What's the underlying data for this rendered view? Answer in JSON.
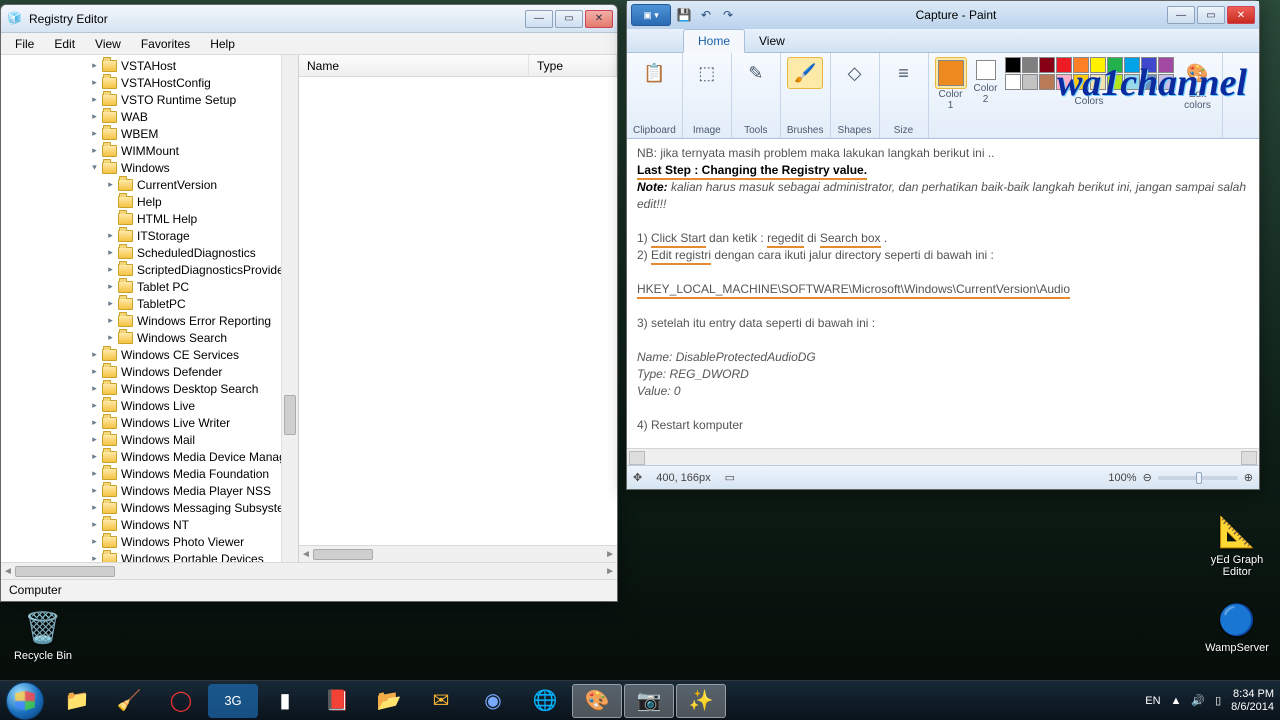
{
  "regedit": {
    "title": "Registry Editor",
    "menu": {
      "file": "File",
      "edit": "Edit",
      "view": "View",
      "favorites": "Favorites",
      "help": "Help"
    },
    "columns": {
      "name": "Name",
      "type": "Type"
    },
    "statusbar": "Computer",
    "tree_level1": [
      {
        "label": "VSTAHost"
      },
      {
        "label": "VSTAHostConfig"
      },
      {
        "label": "VSTO Runtime Setup"
      },
      {
        "label": "WAB"
      },
      {
        "label": "WBEM"
      },
      {
        "label": "WIMMount"
      }
    ],
    "windows_node": "Windows",
    "windows_children": [
      {
        "label": "CurrentVersion",
        "expandable": true
      },
      {
        "label": "Help",
        "expandable": false
      },
      {
        "label": "HTML Help",
        "expandable": false
      },
      {
        "label": "ITStorage",
        "expandable": true
      },
      {
        "label": "ScheduledDiagnostics",
        "expandable": true
      },
      {
        "label": "ScriptedDiagnosticsProvider",
        "expandable": true
      },
      {
        "label": "Tablet PC",
        "expandable": true
      },
      {
        "label": "TabletPC",
        "expandable": true
      },
      {
        "label": "Windows Error Reporting",
        "expandable": true
      },
      {
        "label": "Windows Search",
        "expandable": true
      }
    ],
    "tree_level1b": [
      {
        "label": "Windows CE Services"
      },
      {
        "label": "Windows Defender"
      },
      {
        "label": "Windows Desktop Search"
      },
      {
        "label": "Windows Live"
      },
      {
        "label": "Windows Live Writer"
      },
      {
        "label": "Windows Mail"
      },
      {
        "label": "Windows Media Device Manager"
      },
      {
        "label": "Windows Media Foundation"
      },
      {
        "label": "Windows Media Player NSS"
      },
      {
        "label": "Windows Messaging Subsystem"
      },
      {
        "label": "Windows NT"
      },
      {
        "label": "Windows Photo Viewer"
      },
      {
        "label": "Windows Portable Devices"
      }
    ]
  },
  "paint": {
    "title": "Capture - Paint",
    "tabs": {
      "home": "Home",
      "view": "View"
    },
    "groups": {
      "clipboard": "Clipboard",
      "image": "Image",
      "tools": "Tools",
      "brushes": "Brushes",
      "shapes": "Shapes",
      "size": "Size",
      "color1": "Color\n1",
      "color2": "Color\n2",
      "colors": "Colors",
      "editcolors": "Edit\ncolors"
    },
    "watermark": "wa1channel",
    "doc": {
      "nb": "NB: jika ternyata masih problem maka lakukan langkah berikut ini ..",
      "laststep": "Last Step : Changing the Registry value.",
      "note_label": "Note:",
      "note_text": " kalian harus masuk sebagai administrator, dan perhatikan baik-baik langkah berikut ini, jangan sampai salah edit!!!",
      "l1a": "1)   ",
      "l1_click": "Click Start",
      "l1b": " dan ketik : ",
      "l1_reg": "regedit",
      "l1c": " di ",
      "l1_search": "Search box",
      "l1d": ".",
      "l2a": "2)   ",
      "l2_edit": "Edit registri",
      "l2b": " dengan cara ikuti jalur directory seperti di bawah ini :",
      "path": "HKEY_LOCAL_MACHINE\\SOFTWARE\\Microsoft\\Windows\\CurrentVersion\\Audio",
      "l3": "3)   setelah itu entry data seperti di bawah ini :",
      "name_label": "Name: ",
      "name_val": "DisableProtectedAudioDG",
      "type_label": "Type: ",
      "type_val": "REG_DWORD",
      "value_label": "Value: ",
      "value_val": "0",
      "l4": "4)   Restart komputer"
    },
    "status": {
      "coords": "400, 166px",
      "zoom": "100%"
    },
    "palette_colors": [
      "#000000",
      "#7f7f7f",
      "#880015",
      "#ed1c24",
      "#ff7f27",
      "#fff200",
      "#22b14c",
      "#00a2e8",
      "#3f48cc",
      "#a349a4",
      "#ffffff",
      "#c3c3c3",
      "#b97a57",
      "#ffaec9",
      "#ffc90e",
      "#efe4b0",
      "#b5e61d",
      "#99d9ea",
      "#7092be",
      "#c8bfe7"
    ],
    "color1": "#ed8a1f",
    "color2": "#ffffff"
  },
  "taskbar": {
    "tray": {
      "lang": "EN",
      "time": "8:34 PM",
      "date": "8/6/2014"
    }
  },
  "desktop": {
    "recyclebin": "Recycle Bin",
    "yed": "yEd Graph Editor",
    "wamp": "WampServer"
  }
}
